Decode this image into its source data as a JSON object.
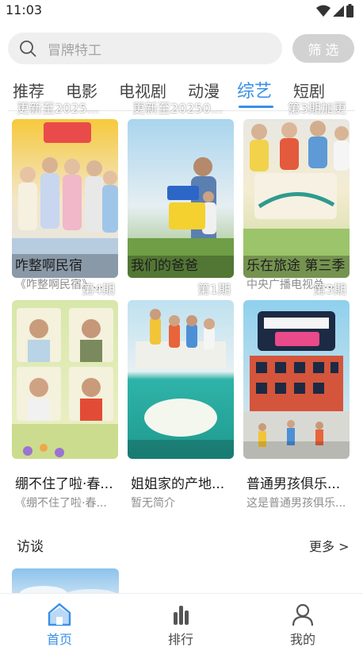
{
  "status_bar": {
    "time": "11:03"
  },
  "search": {
    "placeholder": "冒牌特工",
    "filter_label": "筛选"
  },
  "tabs": [
    {
      "label": "推荐"
    },
    {
      "label": "电影"
    },
    {
      "label": "电视剧"
    },
    {
      "label": "动漫"
    },
    {
      "label": "综艺",
      "active": true
    },
    {
      "label": "短剧"
    }
  ],
  "cards": [
    {
      "title": "咋整啊民宿",
      "desc": "《咋整啊民宿》...",
      "badge": "更新至2025..."
    },
    {
      "title": "我们的爸爸",
      "desc": "",
      "badge": "更新至20250..."
    },
    {
      "title": "乐在旅途 第三季",
      "desc": "中央广播电视总...",
      "badge": "第3期加更"
    },
    {
      "title": "绷不住了啦·春...",
      "desc": "《绷不住了啦·春...",
      "badge": "第4期"
    },
    {
      "title": "姐姐家的产地...",
      "desc": "暂无简介",
      "badge": "第1期"
    },
    {
      "title": "普通男孩俱乐...",
      "desc": "这是普通男孩俱乐...",
      "badge": "第3期"
    }
  ],
  "section": {
    "title": "访谈",
    "more_label": "更多 >"
  },
  "bottom_nav": [
    {
      "label": "首页",
      "icon": "home-icon",
      "active": true
    },
    {
      "label": "排行",
      "icon": "ranking-icon"
    },
    {
      "label": "我的",
      "icon": "profile-icon"
    }
  ],
  "colors": {
    "accent": "#3a8fe8",
    "filter_bg": "#d2d2d2",
    "search_bg": "#efefef"
  }
}
